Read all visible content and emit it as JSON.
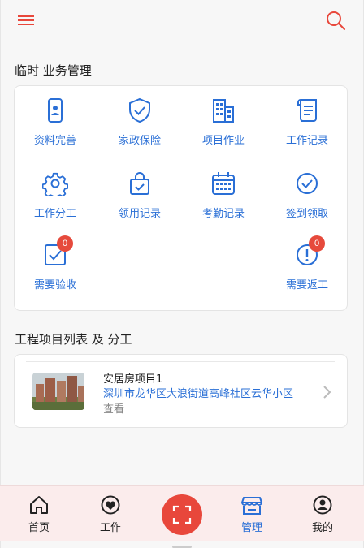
{
  "header": {
    "menu_icon": "hamburger-menu-icon",
    "search_icon": "search-icon",
    "accent_color": "#e8473b"
  },
  "business": {
    "title": "临时 业务管理",
    "items": [
      {
        "label": "资料完善",
        "icon": "id-card-phone-icon"
      },
      {
        "label": "家政保险",
        "icon": "shield-check-icon"
      },
      {
        "label": "项目作业",
        "icon": "buildings-icon"
      },
      {
        "label": "工作记录",
        "icon": "scroll-document-icon"
      },
      {
        "label": "工作分工",
        "icon": "gear-icon"
      },
      {
        "label": "领用记录",
        "icon": "bag-check-icon"
      },
      {
        "label": "考勤记录",
        "icon": "calendar-icon"
      },
      {
        "label": "签到领取",
        "icon": "check-circle-icon"
      },
      {
        "label": "需要验收",
        "icon": "checkbox-icon",
        "badge": "0"
      },
      {
        "label": "需要返工",
        "icon": "exclamation-circle-icon",
        "badge": "0"
      }
    ]
  },
  "projects": {
    "title": "工程项目列表 及 分工",
    "list": [
      {
        "name": "安居房项目1",
        "address": "深圳市龙华区大浪街道高峰社区云华小区",
        "action": "查看"
      }
    ]
  },
  "tabbar": {
    "items": [
      {
        "label": "首页",
        "icon": "home-icon"
      },
      {
        "label": "工作",
        "icon": "heart-circle-icon"
      },
      {
        "label": "管理",
        "icon": "storefront-icon",
        "active": true
      },
      {
        "label": "我的",
        "icon": "user-circle-icon"
      }
    ],
    "scan_icon": "scan-icon",
    "active_color": "#2a6fd6",
    "background": "#fbecec"
  }
}
